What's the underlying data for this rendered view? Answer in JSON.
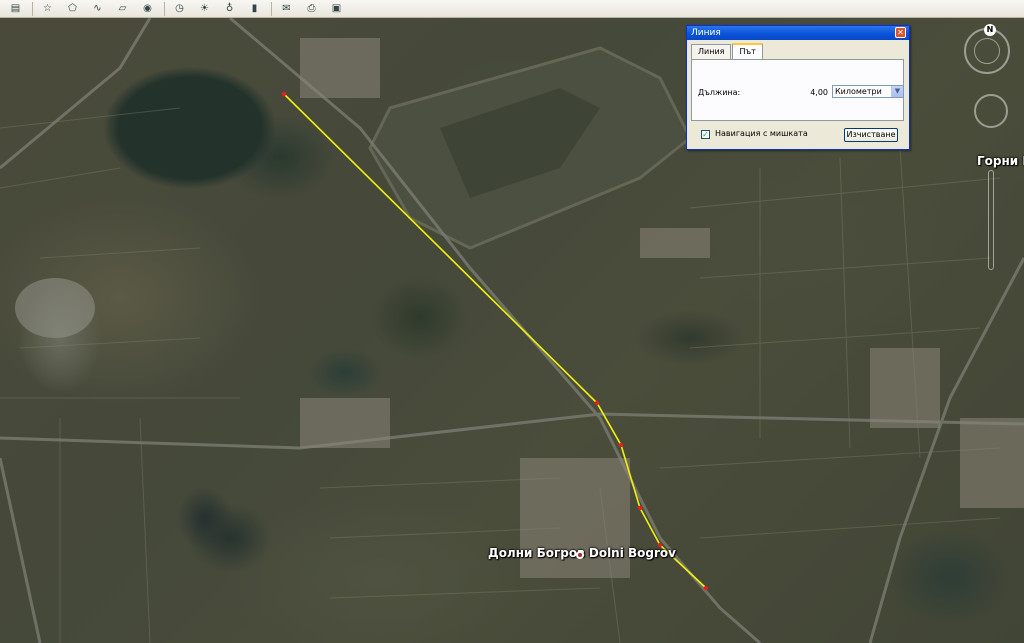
{
  "toolbar": {
    "buttons": [
      {
        "icon": "sidebar-icon",
        "glyph": "▤"
      },
      {
        "icon": "placemark-icon",
        "glyph": "☆"
      },
      {
        "icon": "polygon-icon",
        "glyph": "⬠"
      },
      {
        "icon": "path-icon",
        "glyph": "∿"
      },
      {
        "icon": "image-overlay-icon",
        "glyph": "▱"
      },
      {
        "icon": "tour-icon",
        "glyph": "◉"
      },
      {
        "icon": "historical-imagery-icon",
        "glyph": "◷"
      },
      {
        "icon": "sunlight-icon",
        "glyph": "☀"
      },
      {
        "icon": "planets-icon",
        "glyph": "♁"
      },
      {
        "icon": "ruler-icon",
        "glyph": "▮"
      },
      {
        "icon": "email-icon",
        "glyph": "✉"
      },
      {
        "icon": "print-icon",
        "glyph": "⎙"
      },
      {
        "icon": "save-image-icon",
        "glyph": "▣"
      }
    ]
  },
  "ruler_dialog": {
    "title": "Линия",
    "close_glyph": "✕",
    "tabs": [
      "Линия",
      "Път"
    ],
    "active_tab": "Път",
    "length_label": "Дължина:",
    "length_value": "4,00",
    "unit": "Километри",
    "mouse_nav_checked": true,
    "mouse_nav_label": "Навигация с мишката",
    "clear_label": "Изчистване"
  },
  "map": {
    "places": [
      {
        "label": "Долни Богров  Dolni Bogrov"
      },
      {
        "label": "Горни Б"
      }
    ],
    "compass_north": "N",
    "path_color": "#f2f20a",
    "vertex_color": "#e02020"
  }
}
